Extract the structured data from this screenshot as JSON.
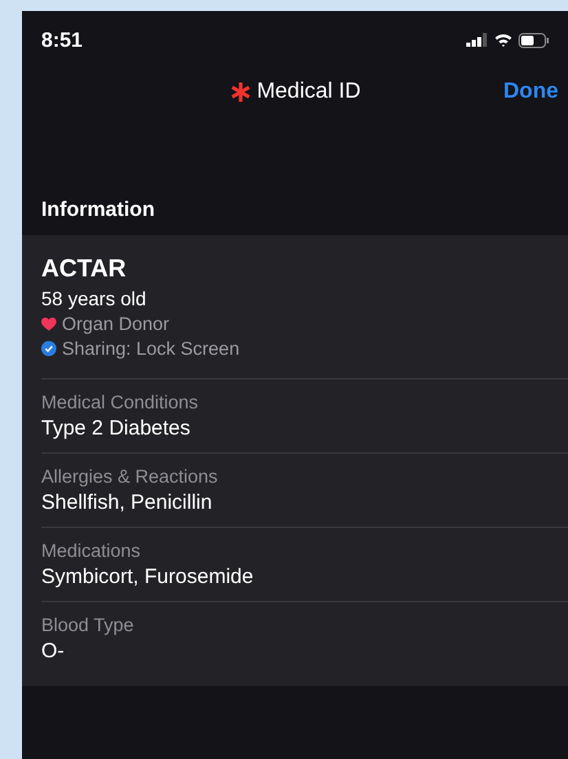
{
  "status_bar": {
    "time": "8:51"
  },
  "nav": {
    "title": "Medical ID",
    "done": "Done"
  },
  "section_header": "Information",
  "profile": {
    "name": "ACTAR",
    "age": "58 years old",
    "badges": [
      {
        "kind": "heart",
        "label": "Organ Donor"
      },
      {
        "kind": "check",
        "label": "Sharing: Lock Screen"
      }
    ]
  },
  "fields": [
    {
      "label": "Medical Conditions",
      "value": "Type 2 Diabetes"
    },
    {
      "label": "Allergies & Reactions",
      "value": "Shellfish, Penicillin"
    },
    {
      "label": "Medications",
      "value": "Symbicort, Furosemide"
    },
    {
      "label": "Blood Type",
      "value": "O-"
    }
  ]
}
